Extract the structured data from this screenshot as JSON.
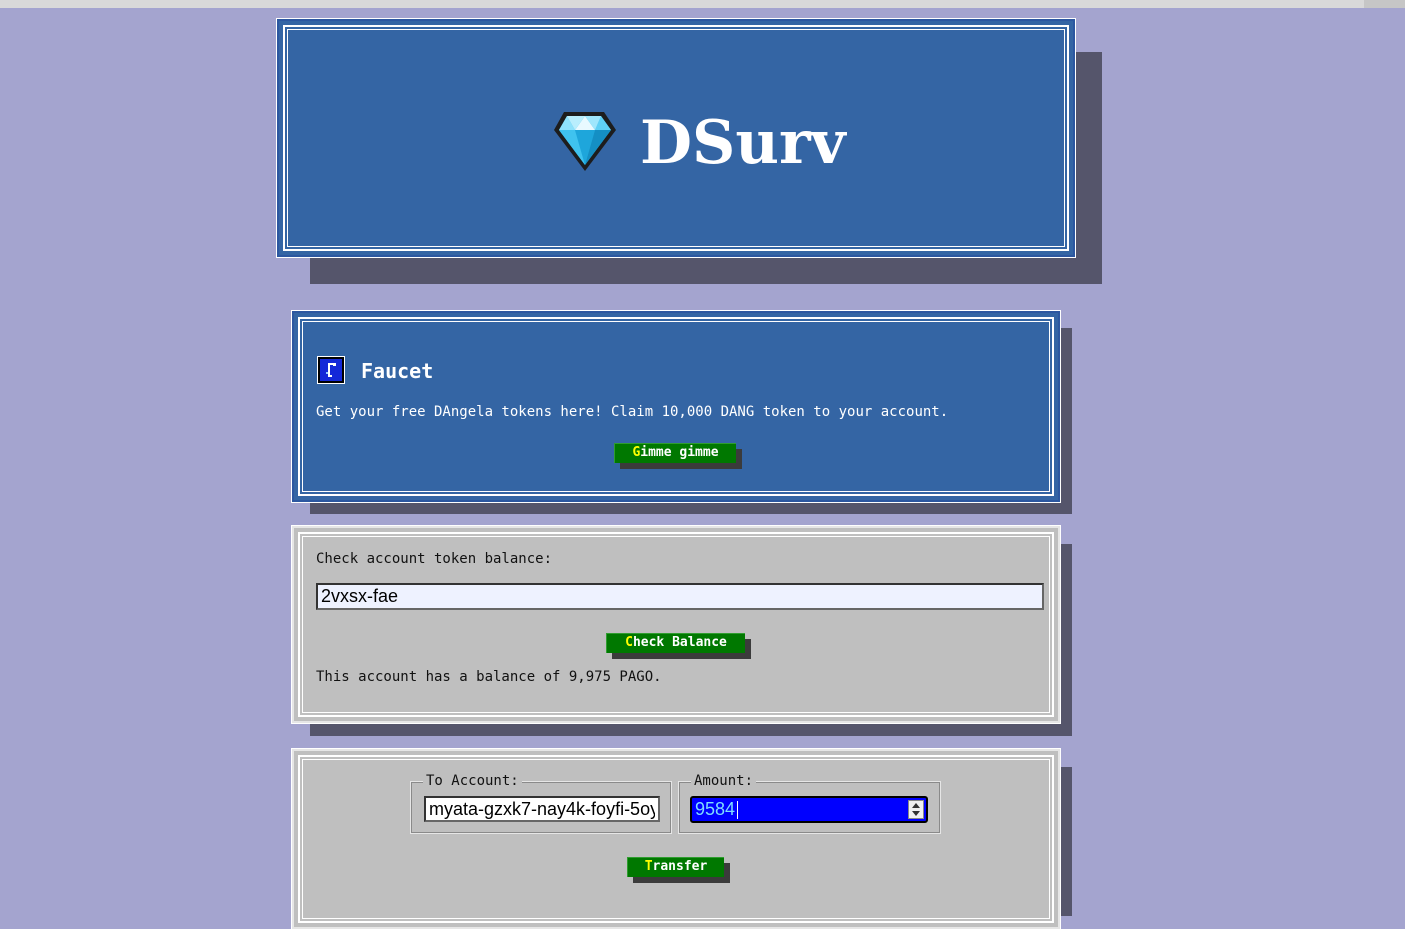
{
  "header": {
    "title": "DSurv",
    "logo_icon": "diamond-icon"
  },
  "faucet": {
    "icon": "faucet-icon",
    "heading": "Faucet",
    "description": "Get your free DAngela tokens here! Claim 10,000 DANG token to your account.",
    "button_first": "G",
    "button_rest": "imme gimme"
  },
  "balance": {
    "prompt": "Check account token balance:",
    "account_value": "2vxsx-fae",
    "button_first": "C",
    "button_rest": "heck Balance",
    "result": "This account has a balance of 9,975 PAGO."
  },
  "transfer": {
    "to_label": "To Account:",
    "to_value": "myata-gzxk7-nay4k-foyfi-5oy",
    "amount_label": "Amount:",
    "amount_value": "9584",
    "button_first": "T",
    "button_rest": "ransfer"
  },
  "colors": {
    "background": "#a4a4cf",
    "panel_blue": "#3465a4",
    "panel_grey": "#bfbfbf",
    "button_green": "#007800",
    "button_accent": "#ffff00",
    "amount_highlight": "#0000ff"
  }
}
